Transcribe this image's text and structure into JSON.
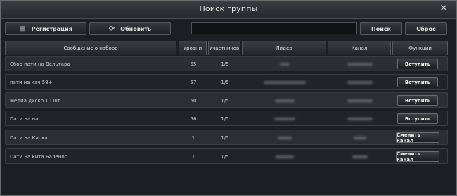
{
  "window": {
    "title": "Поиск группы",
    "close_glyph": "✕"
  },
  "toolbar": {
    "register_label": "Регистрация",
    "refresh_label": "Обновить",
    "search_label": "Поиск",
    "reset_label": "Сброс",
    "search_value": ""
  },
  "table": {
    "headers": [
      "Сообщение о наборе",
      "Уровни",
      "Участников",
      "Лидер",
      "Канал",
      "Функции"
    ],
    "rows": [
      {
        "message": "Сбор пати на Вельтара",
        "level": "55",
        "members": "1/5",
        "action": "Вступить"
      },
      {
        "message": "пати на кач 58+",
        "level": "57",
        "members": "1/5",
        "action": "Вступить"
      },
      {
        "message": "Медиа диско 10 шт",
        "level": "50",
        "members": "1/5",
        "action": "Вступить"
      },
      {
        "message": "Пати на наг",
        "level": "56",
        "members": "1/5",
        "action": "Вступить"
      },
      {
        "message": "Пати на Карка",
        "level": "1",
        "members": "1/5",
        "action": "Сменить канал"
      },
      {
        "message": "Пати на кита Баленос",
        "level": "1",
        "members": "1/5",
        "action": "Сменить канал"
      }
    ]
  },
  "colors": {
    "window_bg": "#1b1e22",
    "row_bg": "#2b2e33",
    "row_alt_bg": "#202327",
    "border": "#54575c"
  },
  "icons": {
    "register": "document-icon",
    "refresh": "refresh-icon",
    "close": "close-icon"
  }
}
